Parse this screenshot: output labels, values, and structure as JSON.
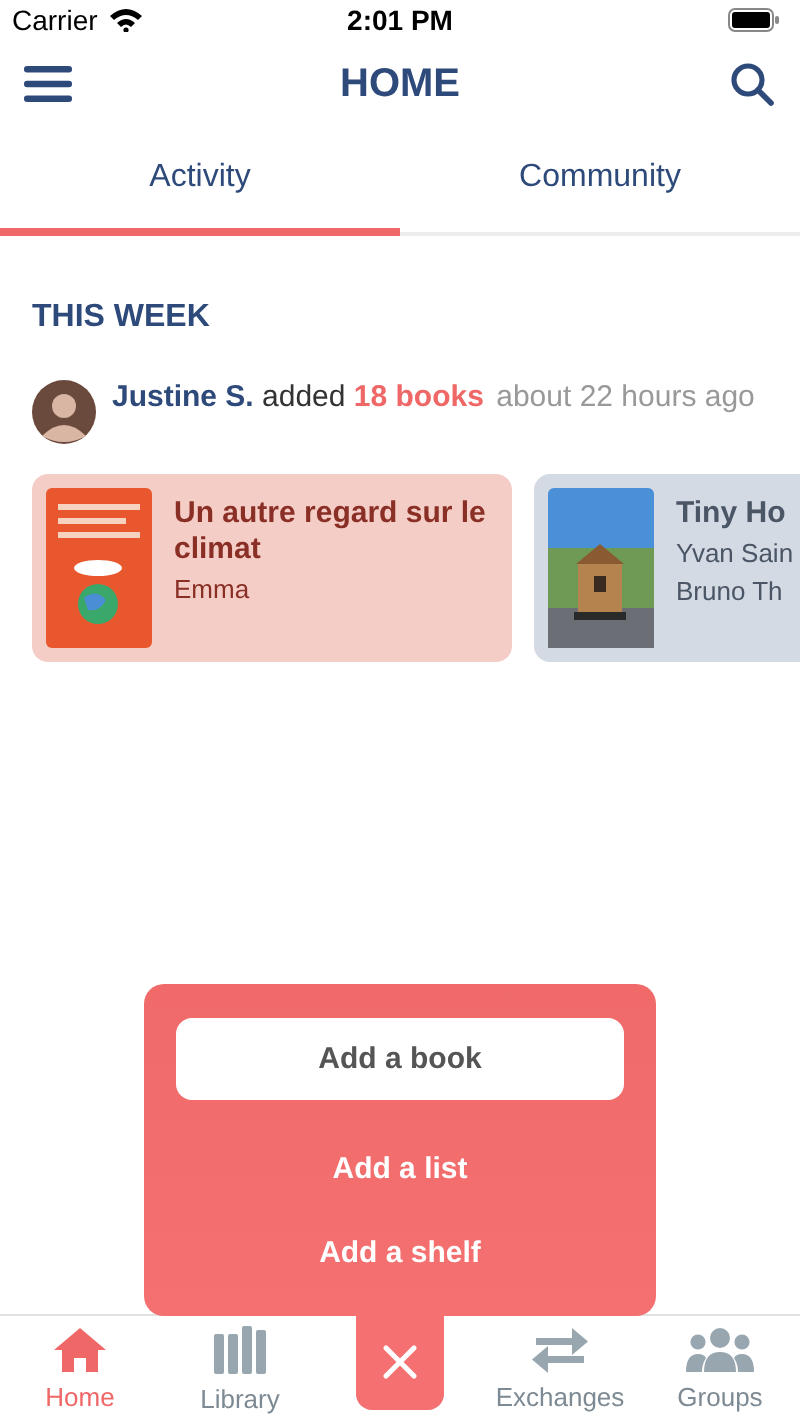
{
  "status_bar": {
    "carrier": "Carrier",
    "time": "2:01 PM"
  },
  "header": {
    "title": "HOME"
  },
  "tabs": [
    {
      "label": "Activity",
      "selected": true
    },
    {
      "label": "Community",
      "selected": false
    }
  ],
  "section": {
    "title": "THIS WEEK"
  },
  "activity": {
    "user": "Justine S.",
    "verb": "added",
    "object": "18 books",
    "time": "about 22 hours ago"
  },
  "books": [
    {
      "title": "Un autre regard sur le climat",
      "authors": [
        "Emma"
      ],
      "color": "#f4cdc6"
    },
    {
      "title": "Tiny Ho",
      "authors": [
        "Yvan Sain",
        "Bruno Th"
      ],
      "color": "#d3dae3"
    }
  ],
  "add_menu": {
    "items": [
      {
        "label": "Add a book",
        "kind": "primary"
      },
      {
        "label": "Add a list",
        "kind": "plain"
      },
      {
        "label": "Add a shelf",
        "kind": "plain"
      }
    ]
  },
  "nav": [
    {
      "label": "Home",
      "selected": true
    },
    {
      "label": "Library",
      "selected": false
    },
    {
      "label": "Exchanges",
      "selected": false
    },
    {
      "label": "Groups",
      "selected": false
    }
  ]
}
